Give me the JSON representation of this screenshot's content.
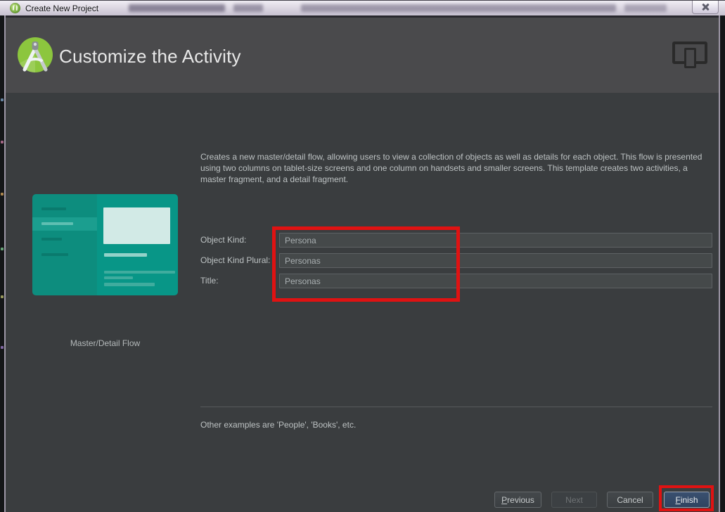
{
  "window": {
    "title": "Create New Project"
  },
  "wizard": {
    "step_title": "Customize the Activity",
    "template": {
      "name": "Master/Detail Flow",
      "description": "Creates a new master/detail flow, allowing users to view a collection of objects as well as details for each object. This flow is presented using two columns on tablet-size screens and one column on handsets and smaller screens. This template creates two activities, a master fragment, and a detail fragment.",
      "examples_note": "Other examples are 'People', 'Books', etc."
    },
    "form": {
      "fields": [
        {
          "label": "Object Kind:",
          "value": "Persona"
        },
        {
          "label": "Object Kind Plural:",
          "value": "Personas"
        },
        {
          "label": "Title:",
          "value": "Personas"
        }
      ]
    },
    "buttons": [
      {
        "label": "Previous",
        "enabled": true
      },
      {
        "label": "Next",
        "enabled": false
      },
      {
        "label": "Cancel",
        "enabled": true
      },
      {
        "label": "Finish",
        "enabled": true,
        "default": true
      }
    ]
  },
  "icons": {
    "titlebar_app": "android-studio-logo",
    "header_logo": "android-studio-compass-logo",
    "form_factor": "tablet-and-phone-outline",
    "close": "window-close-x"
  },
  "annotations": {
    "color": "#E01212",
    "regions": [
      "form-inputs",
      "finish-button"
    ]
  },
  "colors": {
    "titlebar_bg": "#DDD8E3",
    "header_bg": "#4A4A4C",
    "body_bg": "#3A3D3F",
    "input_bg": "#45494A",
    "preview_master_teal": "#0D8D7E",
    "preview_detail_teal": "#089687",
    "default_button_bg": "#34496B",
    "annotation_red": "#E01212"
  }
}
